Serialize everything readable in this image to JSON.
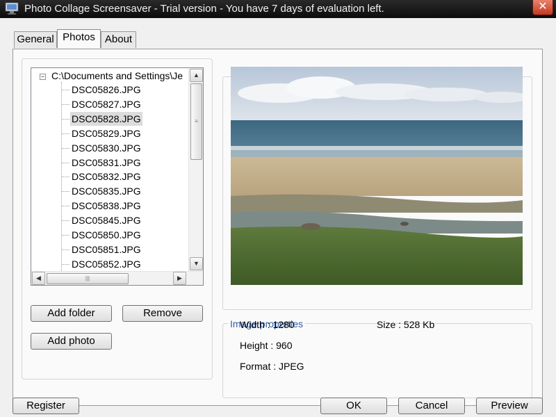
{
  "window": {
    "title": "Photo Collage Screensaver - Trial version - You have 7 days of evaluation left.",
    "close_glyph": "✕"
  },
  "tabs": [
    {
      "label": "General"
    },
    {
      "label": "Photos"
    },
    {
      "label": "About"
    }
  ],
  "tree": {
    "root_label": "C:\\Documents and Settings\\Je",
    "expander": "−",
    "items": [
      {
        "label": "DSC05826.JPG"
      },
      {
        "label": "DSC05827.JPG"
      },
      {
        "label": "DSC05828.JPG"
      },
      {
        "label": "DSC05829.JPG"
      },
      {
        "label": "DSC05830.JPG"
      },
      {
        "label": "DSC05831.JPG"
      },
      {
        "label": "DSC05832.JPG"
      },
      {
        "label": "DSC05835.JPG"
      },
      {
        "label": "DSC05838.JPG"
      },
      {
        "label": "DSC05845.JPG"
      },
      {
        "label": "DSC05850.JPG"
      },
      {
        "label": "DSC05851.JPG"
      },
      {
        "label": "DSC05852.JPG"
      }
    ],
    "selected": "DSC05828.JPG"
  },
  "photo_buttons": {
    "add_folder": "Add folder",
    "remove": "Remove",
    "add_photo": "Add photo"
  },
  "image_properties": {
    "legend": "Image properties",
    "width": "Width : 1280",
    "height": "Height : 960",
    "format": "Format : JPEG",
    "size": "Size : 528 Kb"
  },
  "footer": {
    "register": "Register",
    "ok": "OK",
    "cancel": "Cancel",
    "preview": "Preview"
  },
  "scroll_glyphs": {
    "up": "▲",
    "down": "▼",
    "left": "◀",
    "right": "▶",
    "grip_v": "≡",
    "grip_h": "|||"
  },
  "colors": {
    "titlebar": "#0c0c0c",
    "accent_legend": "#2e5fa8",
    "selection": "#dcdcdc"
  }
}
